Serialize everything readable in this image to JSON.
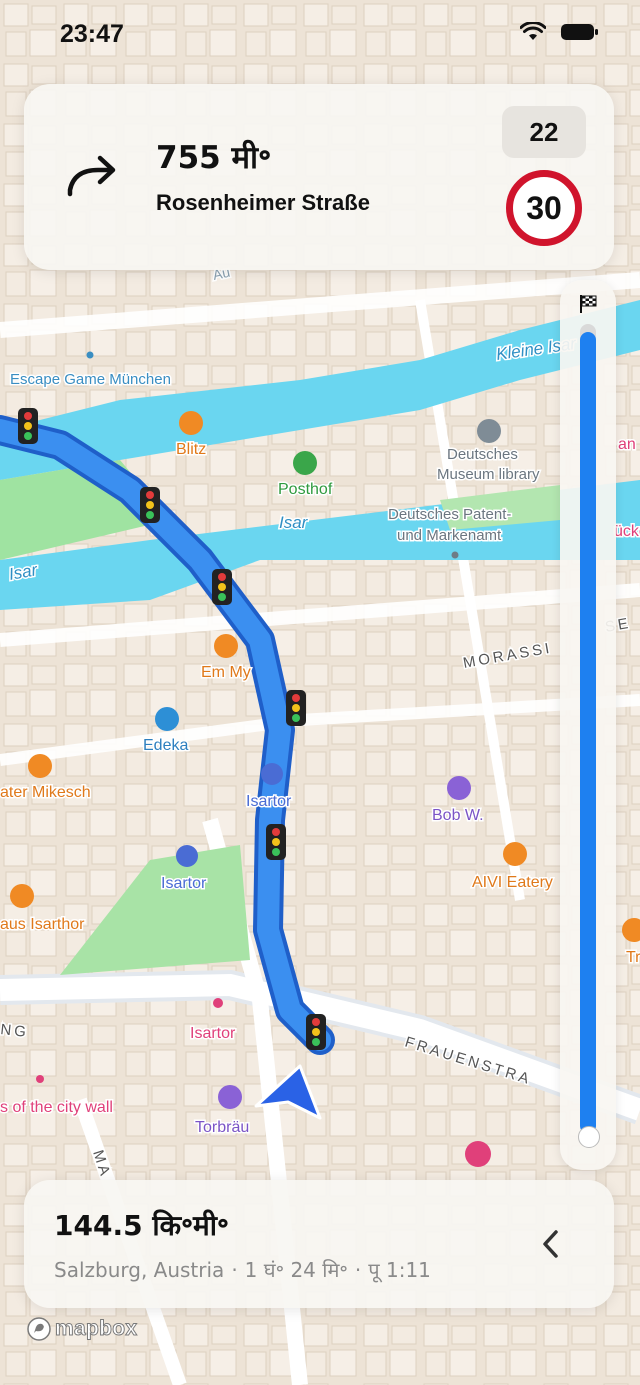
{
  "status_bar": {
    "time": "23:47"
  },
  "maneuver": {
    "turn_icon": "turn-right-arrow-icon",
    "distance": "755 मी॰",
    "street": "Rosenheimer Straße",
    "current_speed": "22",
    "speed_limit": "30",
    "speed_limit_color": "#d0142c"
  },
  "route_progress": {
    "fraction_remaining": 0.99,
    "icon": "finish-flag-icon",
    "color": "#1e80f0"
  },
  "trip_summary": {
    "remaining_distance": "144.5 कि॰मी॰",
    "destination": "Salzburg, Austria",
    "remaining_time": "1 घं॰ 24 मि॰",
    "arrival_time": "पू 1:11",
    "separator": "·",
    "chevron_icon": "chevron-left-icon"
  },
  "attribution": {
    "logo": "mapbox"
  },
  "map": {
    "route_color": "#2f80ed",
    "water_labels": {
      "isar_1": "Isar",
      "isar_2": "Isar",
      "kleine_isar": "Kleine Isar"
    },
    "street_labels": {
      "morassi": "MORASSI",
      "frauenstra": "FRAUENSTRA",
      "ng": "NG",
      "ma": "MA",
      "au": "Au",
      "se": "SE"
    },
    "pois": [
      {
        "label": "Escape Game München",
        "icon": "dot-icon",
        "color": "#3a8ec2"
      },
      {
        "label": "Blitz",
        "icon": "restaurant-icon",
        "color": "#f08a24"
      },
      {
        "label": "Posthof",
        "icon": "tree-icon",
        "color": "#3aa64a"
      },
      {
        "label": "Deutsches Museum library",
        "icon": "library-icon",
        "color": "#7f8c96"
      },
      {
        "label": "Deutsches Patent- und Markenamt",
        "icon": "dot-icon",
        "color": "#6e7c86"
      },
      {
        "label": "Em My",
        "icon": "restaurant-icon",
        "color": "#f08a24"
      },
      {
        "label": "Edeka",
        "icon": "cart-icon",
        "color": "#2d8fd6"
      },
      {
        "label": "ater Mikesch",
        "icon": "restaurant-icon",
        "color": "#f08a24"
      },
      {
        "label": "Isartor",
        "icon": "train-icon",
        "color": "#4a6cd4"
      },
      {
        "label": "Bob W.",
        "icon": "hotel-icon",
        "color": "#8a62d6"
      },
      {
        "label": "Isartor",
        "icon": "train-icon",
        "color": "#4a6cd4"
      },
      {
        "label": "AIVI Eatery",
        "icon": "restaurant-icon",
        "color": "#f08a24"
      },
      {
        "label": "aus Isarthor",
        "icon": "restaurant-icon",
        "color": "#f08a24"
      },
      {
        "label": "Isartor",
        "icon": "landmark-icon",
        "color": "#e0407a"
      },
      {
        "label": "s of the city wall",
        "icon": "dot-icon",
        "color": "#e0407a"
      },
      {
        "label": "Torbräu",
        "icon": "hotel-icon",
        "color": "#8a62d6"
      },
      {
        "label": "an",
        "icon": "dot-icon",
        "color": "#e0407a"
      },
      {
        "label": "ücke",
        "icon": "dot-icon",
        "color": "#e0407a"
      },
      {
        "label": "Tr",
        "icon": "restaurant-icon",
        "color": "#f08a24"
      }
    ]
  }
}
